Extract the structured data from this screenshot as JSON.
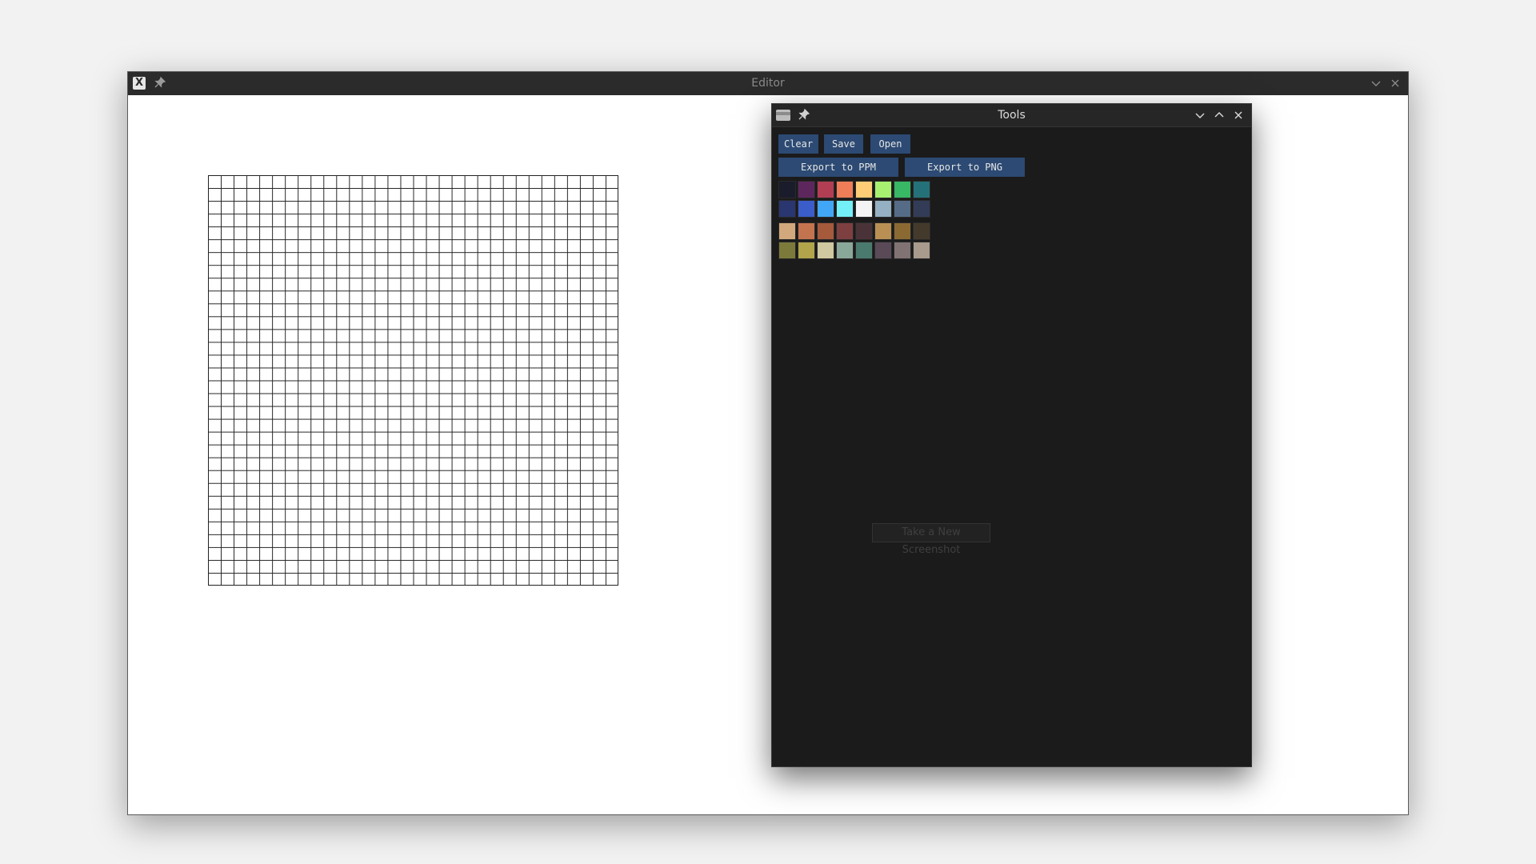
{
  "editor": {
    "title": "Editor",
    "app_icon_glyph": "X"
  },
  "tools": {
    "title": "Tools",
    "buttons": {
      "clear": "Clear",
      "save": "Save",
      "open": "Open",
      "export_ppm": "Export to PPM",
      "export_png": "Export to PNG"
    },
    "palette_group_1": [
      "#1a1c2c",
      "#5d275d",
      "#b13e53",
      "#ef7d57",
      "#ffcd75",
      "#a7f070",
      "#38b764",
      "#257179",
      "#29366f",
      "#3b5dc9",
      "#41a6f6",
      "#73eff7",
      "#f4f4f4",
      "#94b0c2",
      "#566c86",
      "#333c57"
    ],
    "palette_group_2": [
      "#d2a97c",
      "#c4734f",
      "#a55a3c",
      "#7e3f40",
      "#4a3338",
      "#b98f54",
      "#8a6a32",
      "#443a2c",
      "#7c7a3b",
      "#b1a44a",
      "#cfc8a0",
      "#8aa89a",
      "#4a7a6e",
      "#5a4a58",
      "#817273",
      "#a89a8c"
    ],
    "screenshot_button": "Take a New Screenshot"
  },
  "grid": {
    "columns": 32,
    "rows": 32
  }
}
